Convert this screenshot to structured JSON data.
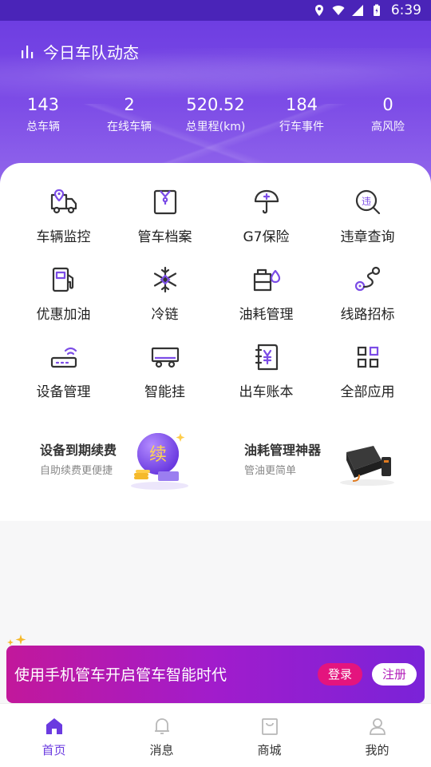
{
  "statusbar": {
    "time": "6:39"
  },
  "header": {
    "title": "今日车队动态"
  },
  "stats": [
    {
      "value": "143",
      "label": "总车辆"
    },
    {
      "value": "2",
      "label": "在线车辆"
    },
    {
      "value": "520.52",
      "label": "总里程(km)"
    },
    {
      "value": "184",
      "label": "行车事件"
    },
    {
      "value": "0",
      "label": "高风险"
    }
  ],
  "grid": [
    {
      "label": "车辆监控",
      "icon": "truck-location-icon"
    },
    {
      "label": "管车档案",
      "icon": "file-folder-icon"
    },
    {
      "label": "G7保险",
      "icon": "umbrella-icon"
    },
    {
      "label": "违章查询",
      "icon": "violation-search-icon"
    },
    {
      "label": "优惠加油",
      "icon": "fuel-pump-icon"
    },
    {
      "label": "冷链",
      "icon": "snowflake-icon"
    },
    {
      "label": "油耗管理",
      "icon": "fuel-tank-icon"
    },
    {
      "label": "线路招标",
      "icon": "route-icon"
    },
    {
      "label": "设备管理",
      "icon": "router-device-icon"
    },
    {
      "label": "智能挂",
      "icon": "trailer-icon"
    },
    {
      "label": "出车账本",
      "icon": "ledger-icon"
    },
    {
      "label": "全部应用",
      "icon": "apps-grid-icon"
    }
  ],
  "promos": {
    "left": {
      "title": "设备到期续费",
      "subtitle": "自助续费更便捷",
      "badge": "续"
    },
    "right": {
      "title": "油耗管理神器",
      "subtitle": "管油更简单"
    }
  },
  "login_banner": {
    "text": "使用手机管车开启管车智能时代",
    "login_label": "登录",
    "register_label": "注册"
  },
  "bottomnav": [
    {
      "label": "首页",
      "icon": "home-icon",
      "active": true
    },
    {
      "label": "消息",
      "icon": "bell-icon",
      "active": false
    },
    {
      "label": "商城",
      "icon": "shopping-bag-icon",
      "active": false
    },
    {
      "label": "我的",
      "icon": "user-icon",
      "active": false
    }
  ],
  "colors": {
    "accent": "#6b3be0",
    "hero_top": "#6a3ae0",
    "banner_start": "#c2189b",
    "banner_end": "#7a23d8",
    "login_button": "#e4147e"
  }
}
